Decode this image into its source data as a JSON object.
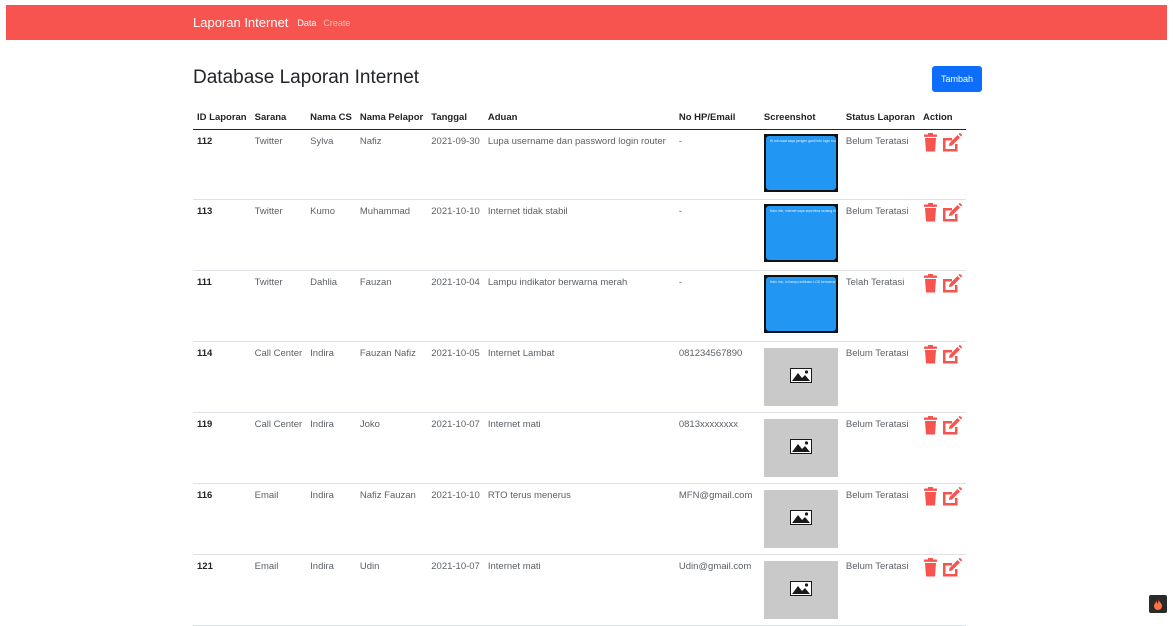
{
  "navbar": {
    "brand": "Laporan Internet",
    "links": [
      {
        "label": "Data"
      },
      {
        "label": "Create"
      }
    ]
  },
  "page": {
    "title": "Database Laporan Internet",
    "add_button": "Tambah"
  },
  "table": {
    "headers": [
      "ID Laporan",
      "Sarana",
      "Nama CS",
      "Nama Pelapor",
      "Tanggal",
      "Aduan",
      "No HP/Email",
      "Screenshot",
      "Status Laporan",
      "Action"
    ],
    "rows": [
      {
        "id": "112",
        "sarana": "Twitter",
        "cs": "Sylva",
        "pelapor": "Nafiz",
        "tanggal": "2021-09-30",
        "aduan": "Lupa username dan password login router",
        "kontak": "-",
        "status": "Belum Teratasi"
      },
      {
        "id": "113",
        "sarana": "Twitter",
        "cs": "Kumo",
        "pelapor": "Muhammad",
        "tanggal": "2021-10-10",
        "aduan": "Internet tidak stabil",
        "kontak": "-",
        "status": "Belum Teratasi"
      },
      {
        "id": "111",
        "sarana": "Twitter",
        "cs": "Dahlia",
        "pelapor": "Fauzan",
        "tanggal": "2021-10-04",
        "aduan": "Lampu indikator berwarna merah",
        "kontak": "-",
        "status": "Telah Teratasi"
      },
      {
        "id": "114",
        "sarana": "Call Center",
        "cs": "Indira",
        "pelapor": "Fauzan Nafiz",
        "tanggal": "2021-10-05",
        "aduan": "Internet Lambat",
        "kontak": "081234567890",
        "status": "Belum Teratasi"
      },
      {
        "id": "119",
        "sarana": "Call Center",
        "cs": "Indira",
        "pelapor": "Joko",
        "tanggal": "2021-10-07",
        "aduan": "Internet mati",
        "kontak": "0813xxxxxxxx",
        "status": "Belum Teratasi"
      },
      {
        "id": "116",
        "sarana": "Email",
        "cs": "Indira",
        "pelapor": "Nafiz Fauzan",
        "tanggal": "2021-10-10",
        "aduan": "RTO terus menerus",
        "kontak": "MFN@gmail.com",
        "status": "Belum Teratasi"
      },
      {
        "id": "121",
        "sarana": "Email",
        "cs": "Indira",
        "pelapor": "Udin",
        "tanggal": "2021-10-07",
        "aduan": "Internet mati",
        "kontak": "Udin@gmail.com",
        "status": "Belum Teratasi"
      }
    ]
  },
  "icons": {
    "delete": "trash-icon",
    "edit": "edit-icon",
    "image": "image-placeholder-icon"
  },
  "colors": {
    "navbar": "#f7534f",
    "primary": "#0d6efd",
    "action": "#f7534f",
    "screenshot_blue": "#2196f3"
  }
}
